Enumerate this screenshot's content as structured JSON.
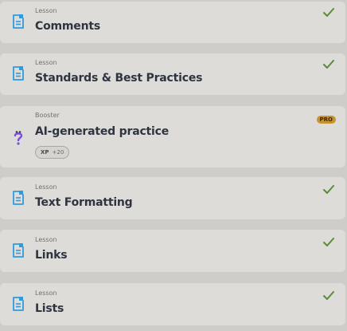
{
  "colors": {
    "background": "#cfcdc9",
    "card": "#dedcd8",
    "lesson_icon": "#2f9bdc",
    "check": "#5b8a3a",
    "pro_badge": "#c8922e",
    "booster_icon": "#7b4fd6"
  },
  "items": [
    {
      "kind": "Lesson",
      "title": "Comments",
      "icon": "document-icon",
      "completed": true
    },
    {
      "kind": "Lesson",
      "title": "Standards & Best Practices",
      "icon": "document-icon",
      "completed": true
    },
    {
      "kind": "Booster",
      "title": "AI-generated practice",
      "icon": "question-mark-icon",
      "badge": "PRO",
      "xp_label": "XP",
      "xp_value": "+20"
    },
    {
      "kind": "Lesson",
      "title": "Text Formatting",
      "icon": "document-icon",
      "completed": true
    },
    {
      "kind": "Lesson",
      "title": "Links",
      "icon": "document-icon",
      "completed": true
    },
    {
      "kind": "Lesson",
      "title": "Lists",
      "icon": "document-icon",
      "completed": true
    }
  ]
}
